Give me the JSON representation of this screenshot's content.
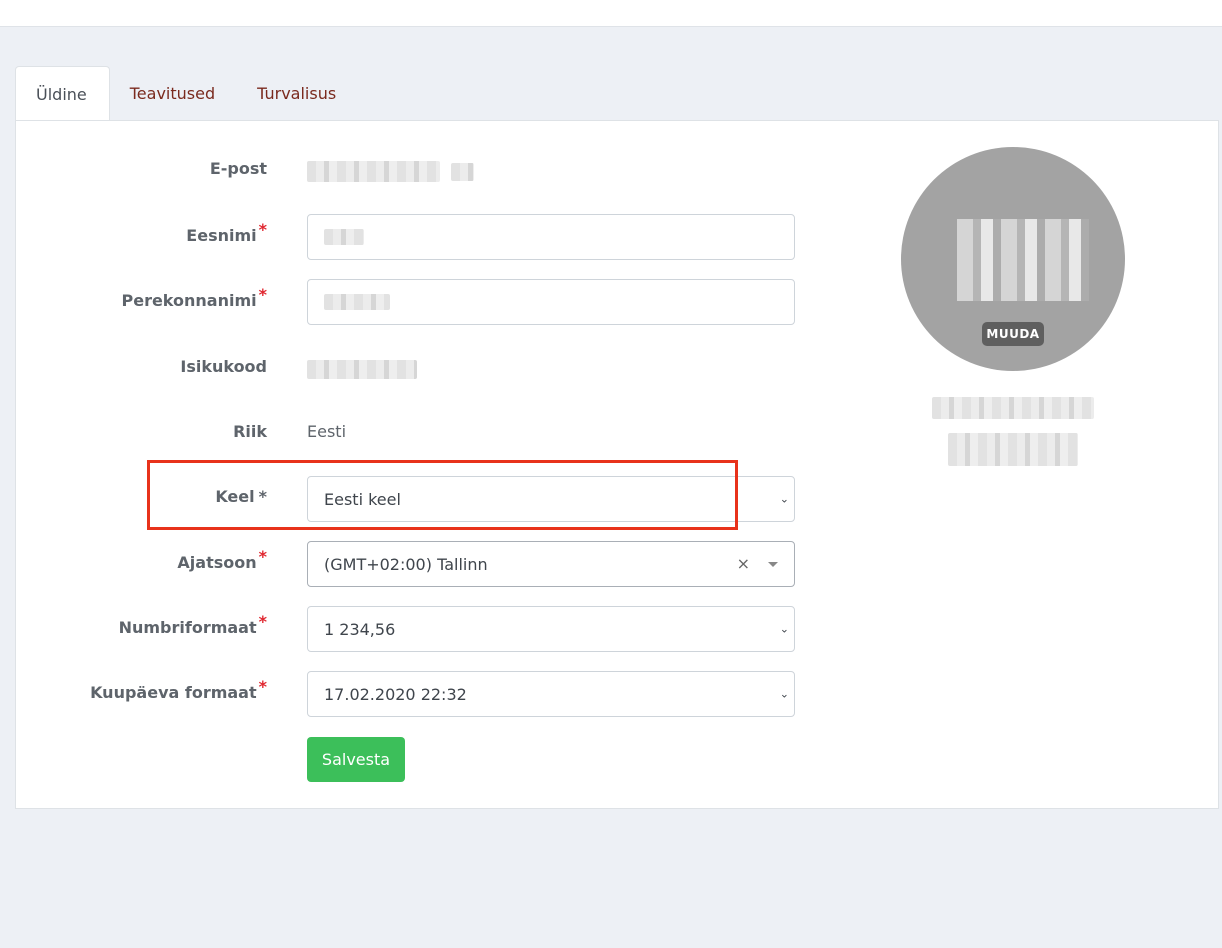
{
  "tabs": [
    {
      "label": "Üldine",
      "active": true
    },
    {
      "label": "Teavitused",
      "active": false
    },
    {
      "label": "Turvalisus",
      "active": false
    }
  ],
  "form": {
    "email_label": "E-post",
    "first_name_label": "Eesnimi",
    "last_name_label": "Perekonnanimi",
    "personal_code_label": "Isikukood",
    "country_label": "Riik",
    "country_value": "Eesti",
    "language_label": "Keel",
    "language_value": "Eesti keel",
    "timezone_label": "Ajatsoon",
    "timezone_value": "(GMT+02:00) Tallinn",
    "timezone_clear": "×",
    "number_format_label": "Numbriformaat",
    "number_format_value": "1 234,56",
    "date_format_label": "Kuupäeva formaat",
    "date_format_value": "17.02.2020 22:32",
    "required_mark": "*",
    "save_label": "Salvesta"
  },
  "avatar": {
    "change_label": "MUUDA"
  },
  "colors": {
    "accent_tab": "#7a2a1e",
    "required": "#e0262f",
    "save_button": "#3cbf5a",
    "highlight": "#e8321b"
  }
}
